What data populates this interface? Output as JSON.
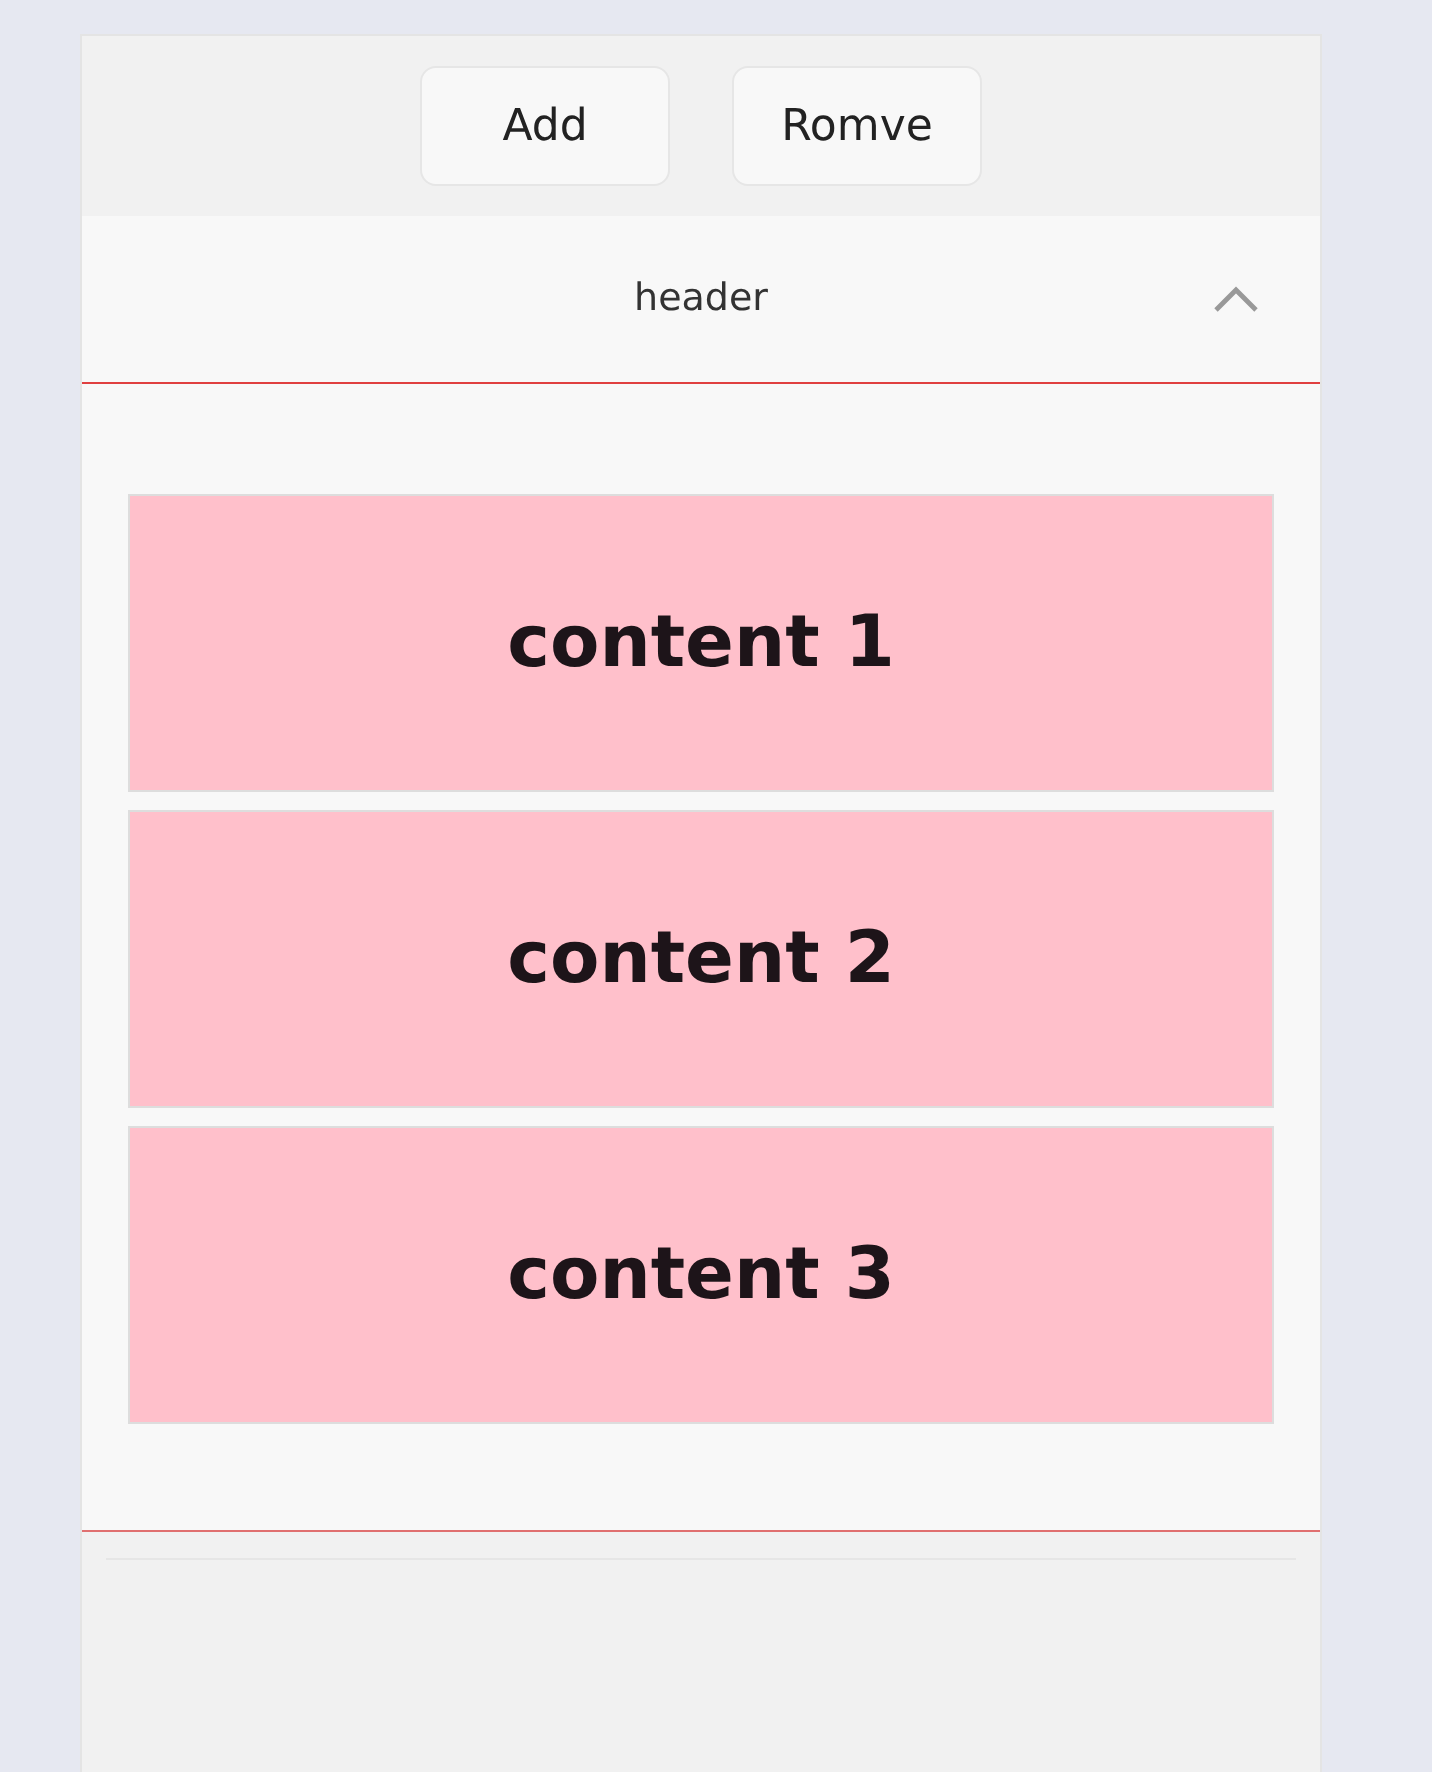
{
  "buttons": [
    {
      "label": "Add"
    },
    {
      "label": "Romve"
    }
  ],
  "collapse": {
    "header": "header",
    "expanded": true,
    "items": [
      {
        "label": "content 1"
      },
      {
        "label": "content 2"
      },
      {
        "label": "content 3"
      }
    ]
  }
}
